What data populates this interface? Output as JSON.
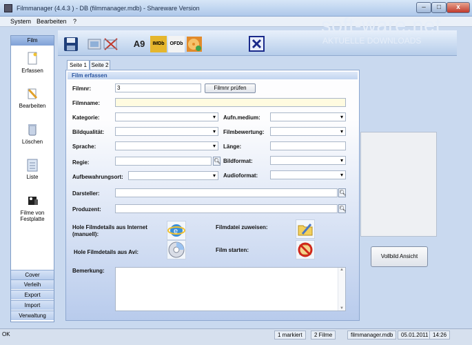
{
  "window": {
    "title": "Filmmanager (4.4.3 ) - DB  (filmmanager.mdb) - Shareware Version",
    "min": "–",
    "max": "□",
    "close": "x"
  },
  "menu": [
    "System",
    "Bearbeiten",
    "?"
  ],
  "watermark": {
    "logo": "soft-ware.net",
    "sub": "AKTUELLE DOWNLOADS"
  },
  "nav": {
    "header": "Film",
    "items": [
      {
        "label": "Erfassen",
        "icon": "new-document-icon"
      },
      {
        "label": "Bearbeiten",
        "icon": "pencil-icon"
      },
      {
        "label": "Löschen",
        "icon": "trash-icon"
      },
      {
        "label": "Liste",
        "icon": "list-icon"
      },
      {
        "label": "Filme von Festplatte",
        "icon": "camera-hdd-icon"
      }
    ],
    "bottom": [
      "Cover",
      "Verleih",
      "Export",
      "Import",
      "Verwaltung"
    ]
  },
  "toolbar": {
    "icons": [
      "save-icon",
      "image-cancel-icon",
      "amazon-icon",
      "imdb-icon",
      "ofdb-icon",
      "dvd-icon",
      "close-icon"
    ],
    "text": {
      "amazon": "A9",
      "imdb": "IMDb",
      "ofdb": "OFDb"
    }
  },
  "tabs": [
    "Seite 1",
    "Seite 2"
  ],
  "form": {
    "header": "Film erfassen",
    "filmnr_label": "Filmnr:",
    "filmnr_value": "3",
    "check_button": "Filmnr prüfen",
    "filmname_label": "Filmname:",
    "kategorie": "Kategorie:",
    "bildqualitaet": "Bildqualität:",
    "sprache": "Sprache:",
    "regie": "Regie:",
    "aufbewahrungsort": "Aufbewahrungsort:",
    "aufnmedium": "Aufn.medium:",
    "filmbewertung": "Filmbewertung:",
    "laenge": "Länge:",
    "bildformat": "Bildformat:",
    "audioformat": "Audioformat:",
    "darsteller": "Darsteller:",
    "produzent": "Produzent:",
    "hole_internet": "Hole Filmdetails aus Internet (manuell):",
    "hole_avi": "Hole Filmdetails aus Avi:",
    "filmdatei": "Filmdatei zuweisen:",
    "film_starten": "Film starten:",
    "bemerkung": "Bemerkung:"
  },
  "right": {
    "vollbild": "Vollbild Ansicht"
  },
  "status": {
    "left": "OK",
    "markiert": "1 markiert",
    "filme": "2 Filme",
    "db": "filmmanager.mdb",
    "date": "05.01.2011",
    "time": "14:26"
  },
  "colors": {
    "accent": "#2a55a0",
    "panel": "#b8cbec",
    "filmname_bg": "#fffbe0"
  }
}
